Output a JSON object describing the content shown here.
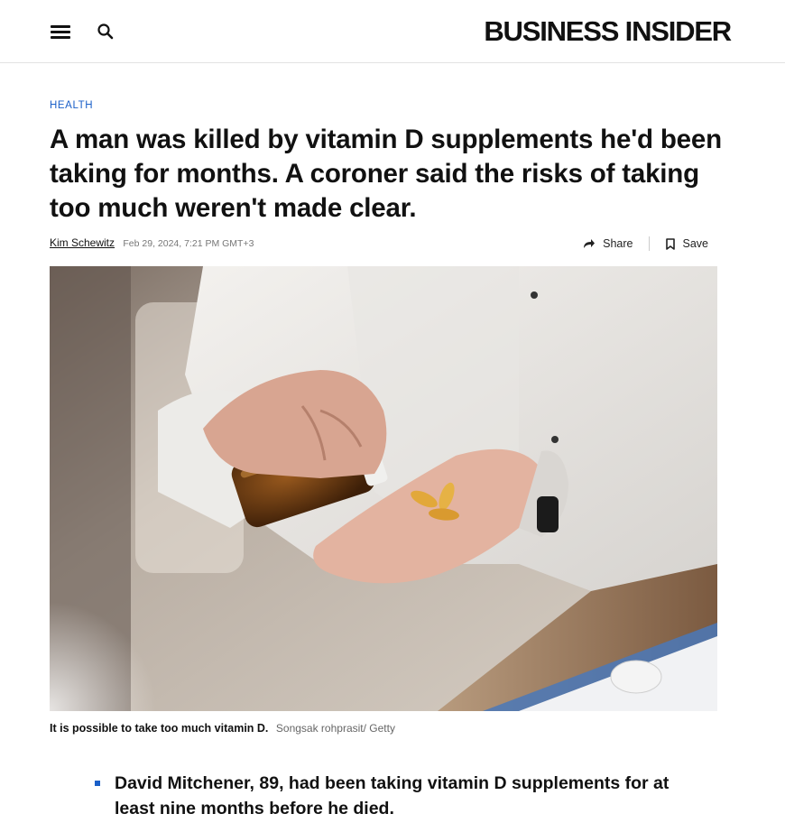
{
  "header": {
    "logo_text": "BUSINESS INSIDER",
    "menu_icon": "hamburger-menu-icon",
    "search_icon": "search-icon"
  },
  "article": {
    "category": "HEALTH",
    "headline": "A man was killed by vitamin D supplements he'd been taking for months. A coroner said the risks of taking too much weren't made clear.",
    "author": "Kim Schewitz",
    "date": "Feb 29, 2024, 7:21 PM GMT+3",
    "share_label": "Share",
    "save_label": "Save",
    "image": {
      "caption": "It is possible to take too much vitamin D.",
      "credit": "Songsak rohprasit/ Getty"
    },
    "key_points": [
      "David Mitchener, 89, had been taking vitamin D supplements for at least nine months before he died."
    ]
  },
  "colors": {
    "accent": "#1a5fc8",
    "text": "#111111",
    "muted": "#777777"
  }
}
